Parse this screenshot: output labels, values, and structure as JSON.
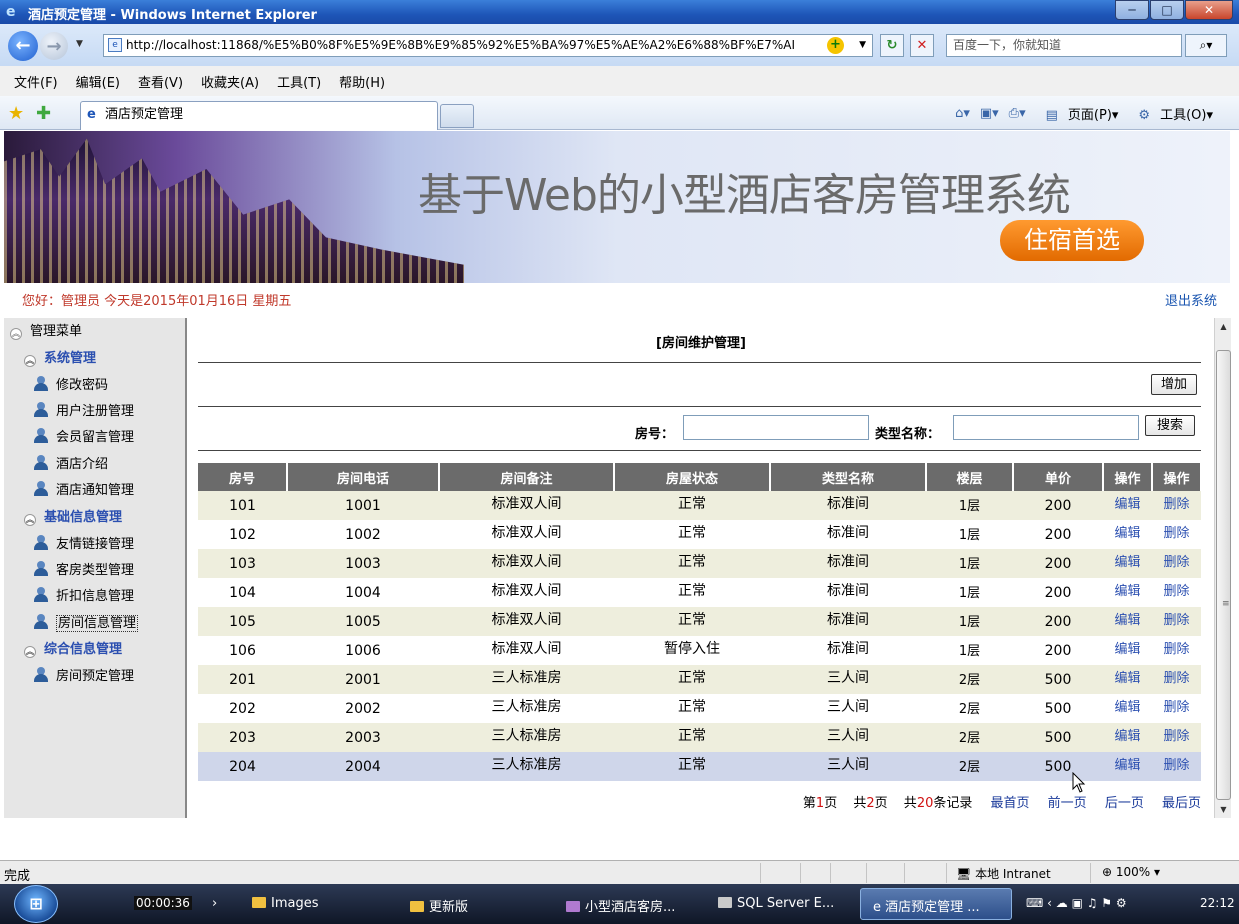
{
  "window": {
    "title": "酒店预定管理 - Windows Internet Explorer",
    "minimize": "─",
    "maximize": "□",
    "close": "✕"
  },
  "address": {
    "url": "http://localhost:11868/%E5%B0%8F%E5%9E%8B%E9%85%92%E5%BA%97%E5%AE%A2%E6%88%BF%E7%AI",
    "search_placeholder": "百度一下，你就知道"
  },
  "menubar": [
    "文件(F)",
    "编辑(E)",
    "查看(V)",
    "收藏夹(A)",
    "工具(T)",
    "帮助(H)"
  ],
  "tab": {
    "label": "酒店预定管理"
  },
  "commandbar": {
    "page": "页面(P)",
    "tools": "工具(O)"
  },
  "banner": {
    "title": "基于Web的小型酒店客房管理系统",
    "badge": "住宿首选"
  },
  "greeting": {
    "text": "您好：管理员   今天是2015年01月16日   星期五",
    "logout": "退出系统"
  },
  "sidebar": {
    "root": "管理菜单",
    "groups": [
      {
        "label": "系统管理",
        "items": [
          "修改密码",
          "用户注册管理",
          "会员留言管理",
          "酒店介绍",
          "酒店通知管理"
        ]
      },
      {
        "label": "基础信息管理",
        "items": [
          "友情链接管理",
          "客房类型管理",
          "折扣信息管理",
          "房间信息管理"
        ]
      },
      {
        "label": "综合信息管理",
        "items": [
          "房间预定管理"
        ]
      }
    ]
  },
  "main": {
    "title": "[房间维护管理]",
    "add_button": "增加",
    "room_no_label": "房号：",
    "type_name_label": "类型名称：",
    "search_button": "搜索",
    "columns": [
      "房号",
      "房间电话",
      "房间备注",
      "房屋状态",
      "类型名称",
      "楼层",
      "单价",
      "操作",
      "操作"
    ],
    "edit_label": "编辑",
    "delete_label": "删除",
    "rows": [
      [
        "101",
        "1001",
        "标准双人间",
        "正常",
        "标准间",
        "1层",
        "200"
      ],
      [
        "102",
        "1002",
        "标准双人间",
        "正常",
        "标准间",
        "1层",
        "200"
      ],
      [
        "103",
        "1003",
        "标准双人间",
        "正常",
        "标准间",
        "1层",
        "200"
      ],
      [
        "104",
        "1004",
        "标准双人间",
        "正常",
        "标准间",
        "1层",
        "200"
      ],
      [
        "105",
        "1005",
        "标准双人间",
        "正常",
        "标准间",
        "1层",
        "200"
      ],
      [
        "106",
        "1006",
        "标准双人间",
        "暂停入住",
        "标准间",
        "1层",
        "200"
      ],
      [
        "201",
        "2001",
        "三人标准房",
        "正常",
        "三人间",
        "2层",
        "500"
      ],
      [
        "202",
        "2002",
        "三人标准房",
        "正常",
        "三人间",
        "2层",
        "500"
      ],
      [
        "203",
        "2003",
        "三人标准房",
        "正常",
        "三人间",
        "2层",
        "500"
      ],
      [
        "204",
        "2004",
        "三人标准房",
        "正常",
        "三人间",
        "2层",
        "500"
      ]
    ],
    "pager": {
      "page_prefix": "第",
      "page_current": "1",
      "page_suffix": "页",
      "total_prefix": "共",
      "total_pages": "2",
      "total_suffix": "页",
      "records_prefix": "共",
      "records": "20",
      "records_suffix": "条记录",
      "first": "最首页",
      "prev": "前一页",
      "next": "后一页",
      "last": "最后页"
    }
  },
  "statusbar": {
    "text": "完成",
    "zone": "本地 Intranet",
    "zoom": "100%"
  },
  "taskbar": {
    "timer": "00:00:36",
    "items": [
      "Images",
      "更新版",
      "小型酒店客房...",
      "SQL Server E...",
      "酒店预定管理 ..."
    ],
    "clock": "22:12"
  }
}
